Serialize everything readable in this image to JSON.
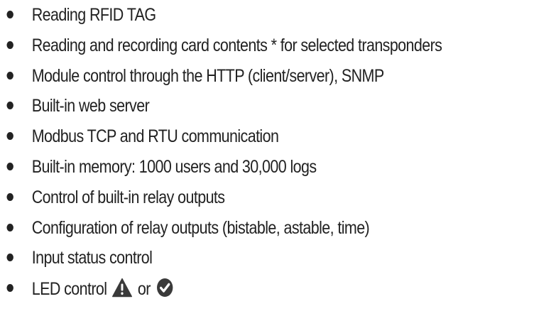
{
  "features": [
    {
      "text": "Reading RFID TAG"
    },
    {
      "text": "Reading and recording card contents * for selected transponders"
    },
    {
      "text": "Module control through the HTTP (client/server), SNMP"
    },
    {
      "text": "Built-in web server"
    },
    {
      "text": "Modbus TCP and RTU communication"
    },
    {
      "text": "Built-in memory: 1000 users and 30,000 logs"
    },
    {
      "text": "Control of built-in relay outputs"
    },
    {
      "text": "Configuration of relay outputs (bistable, astable, time)"
    },
    {
      "text": "Input status control"
    }
  ],
  "led_item": {
    "prefix": "LED control",
    "conjunction": "or",
    "icons": [
      "warning-icon",
      "check-circle-icon"
    ]
  },
  "colors": {
    "text": "#222222",
    "icon": "#3a3a3a"
  }
}
